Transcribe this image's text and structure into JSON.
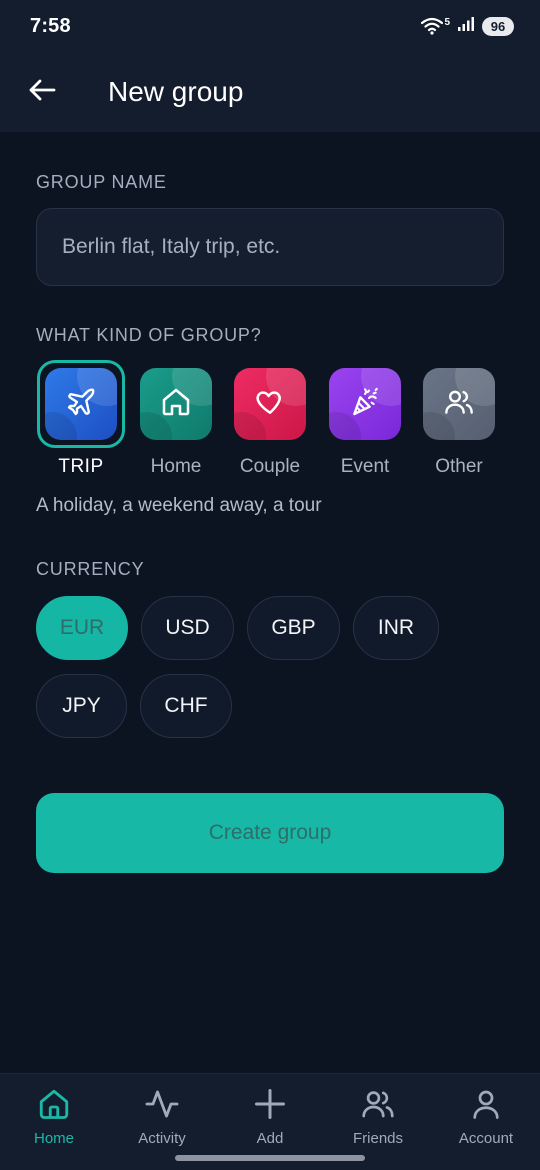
{
  "status_bar": {
    "time": "7:58",
    "network": "5",
    "battery": "96"
  },
  "app_bar": {
    "back_icon": "arrow-left-icon",
    "title": "New group"
  },
  "group_name": {
    "label": "GROUP NAME",
    "value": "",
    "placeholder": "Berlin flat, Italy trip, etc."
  },
  "group_kind": {
    "label": "WHAT KIND OF GROUP?",
    "selected": "TRIP",
    "description": "A holiday, a weekend away, a tour",
    "options": [
      {
        "label": "TRIP",
        "icon": "airplane-icon",
        "color": "#2563d6"
      },
      {
        "label": "Home",
        "icon": "home-icon",
        "color": "#138a7b"
      },
      {
        "label": "Couple",
        "icon": "heart-icon",
        "color": "#dc1f55"
      },
      {
        "label": "Event",
        "icon": "party-popper-icon",
        "color": "#8c33e6"
      },
      {
        "label": "Other",
        "icon": "users-icon",
        "color": "#5c6779"
      }
    ]
  },
  "currency": {
    "label": "CURRENCY",
    "selected": "EUR",
    "options": [
      "EUR",
      "USD",
      "GBP",
      "INR",
      "JPY",
      "CHF"
    ]
  },
  "create_button": {
    "label": "Create group",
    "color": "#17b8a6"
  },
  "bottom_nav": {
    "active": "Home",
    "items": [
      {
        "label": "Home",
        "icon": "home-icon"
      },
      {
        "label": "Activity",
        "icon": "activity-icon"
      },
      {
        "label": "Add",
        "icon": "plus-icon"
      },
      {
        "label": "Friends",
        "icon": "users-icon"
      },
      {
        "label": "Account",
        "icon": "user-icon"
      }
    ]
  },
  "colors": {
    "background": "#0c1422",
    "surface": "#141d2e",
    "accent": "#17b8a6"
  }
}
